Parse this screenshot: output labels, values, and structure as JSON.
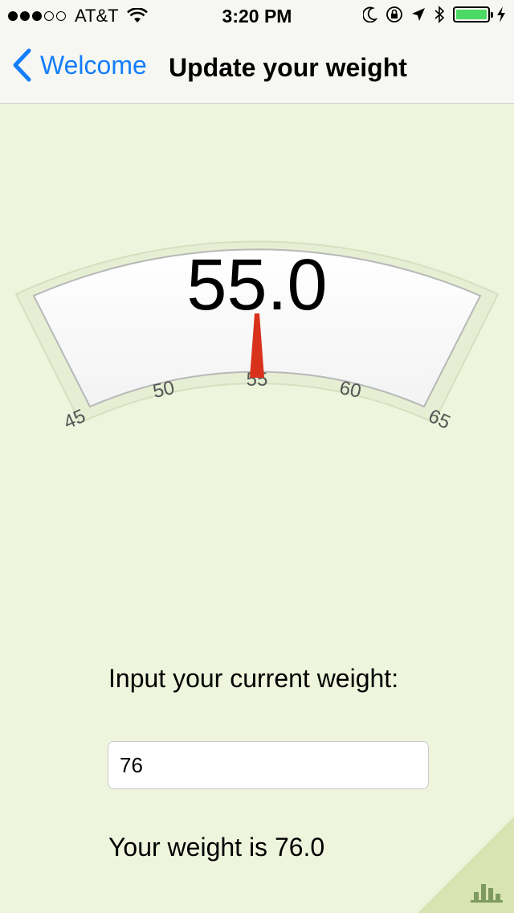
{
  "status_bar": {
    "signal_full": 3,
    "signal_empty": 2,
    "carrier": "AT&T",
    "time": "3:20 PM",
    "icons": [
      "wifi-icon",
      "moon-icon",
      "rotation-lock-icon",
      "location-arrow-icon",
      "bluetooth-icon",
      "battery-icon",
      "charging-bolt-icon"
    ],
    "battery_color": "#4cd964"
  },
  "nav": {
    "back_label": "Welcome",
    "title": "Update your weight"
  },
  "scale": {
    "display_value": "55.0",
    "needle_value": 55.0,
    "tick_labels": [
      "45",
      "50",
      "55",
      "60",
      "65"
    ],
    "range": [
      43,
      67
    ],
    "needle_color": "#d9321c"
  },
  "form": {
    "prompt": "Input your current weight:",
    "input_value": "76",
    "result_text": "Your weight is 76.0"
  },
  "colors": {
    "background": "#eef5dc",
    "accent": "#147efb"
  }
}
